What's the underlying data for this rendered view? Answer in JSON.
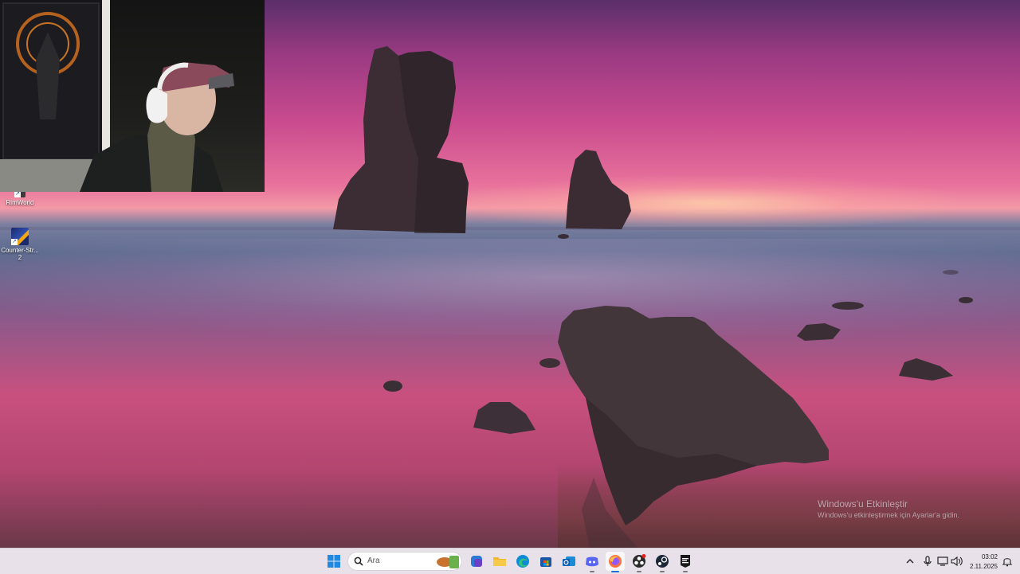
{
  "desktop": {
    "icons": [
      {
        "label": "RimWorld"
      },
      {
        "label": "Counter-Strike 2",
        "label_line1": "Counter-Str...",
        "label_line2": "2"
      }
    ]
  },
  "watermark": {
    "title": "Windows'u Etkinleştir",
    "subtitle": "Windows'u etkinleştirmek için Ayarlar'a gidin."
  },
  "taskbar": {
    "search_placeholder": "Ara",
    "apps": [
      "start-icon",
      "search",
      "weather-widget",
      "copilot",
      "file-explorer",
      "edge",
      "store",
      "outlook",
      "discord",
      "firefox",
      "obs",
      "steam",
      "epic-games"
    ],
    "clock": {
      "time": "03:02",
      "date": "2.11.2025"
    }
  },
  "colors": {
    "taskbar_bg": "#e8e1ea",
    "sky_pink": "#e8739c",
    "sky_purple": "#5a2f6a",
    "accent_blue": "#1f6fd6"
  }
}
